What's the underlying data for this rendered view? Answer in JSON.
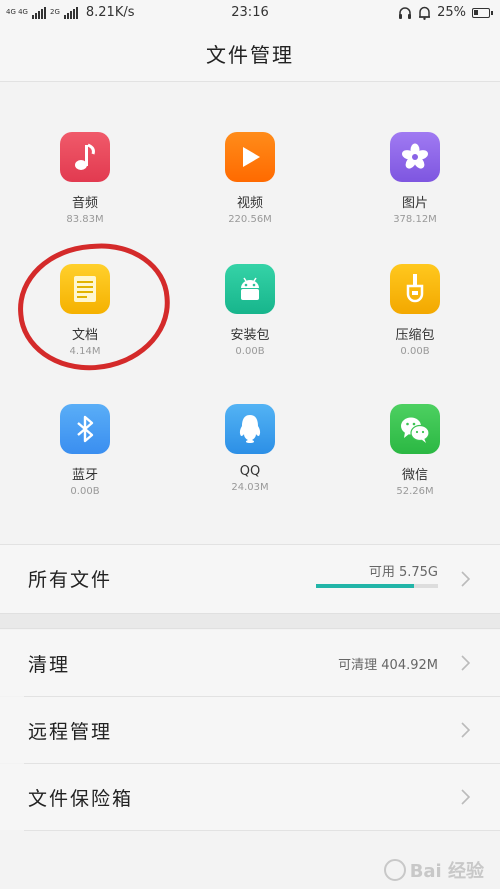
{
  "status_bar": {
    "signal_labels": [
      "4G 4G",
      "2G"
    ],
    "speed": "8.21K/s",
    "time": "23:16",
    "battery": "25%",
    "icons": [
      "headset-icon",
      "bell-icon",
      "battery-icon"
    ]
  },
  "header": {
    "title": "文件管理"
  },
  "categories": [
    {
      "name": "音频",
      "size": "83.83M",
      "icon": "music-icon",
      "color": "#f05a6a",
      "color2": "#e23a50"
    },
    {
      "name": "视频",
      "size": "220.56M",
      "icon": "play-icon",
      "color": "#ff8c1a",
      "color2": "#ff6a00"
    },
    {
      "name": "图片",
      "size": "378.12M",
      "icon": "flower-icon",
      "color": "#a07af2",
      "color2": "#7e56e0"
    },
    {
      "name": "文档",
      "size": "4.14M",
      "icon": "document-icon",
      "color": "#ffd02c",
      "color2": "#f5b100"
    },
    {
      "name": "安装包",
      "size": "0.00B",
      "icon": "android-icon",
      "color": "#35d3a7",
      "color2": "#17b58c"
    },
    {
      "name": "压缩包",
      "size": "0.00B",
      "icon": "zip-icon",
      "color": "#ffc81e",
      "color2": "#f3a800"
    },
    {
      "name": "蓝牙",
      "size": "0.00B",
      "icon": "bluetooth-icon",
      "color": "#5aaef7",
      "color2": "#3a8ef0"
    },
    {
      "name": "QQ",
      "size": "24.03M",
      "icon": "qq-icon",
      "color": "#53b3f4",
      "color2": "#2c8fe6"
    },
    {
      "name": "微信",
      "size": "52.26M",
      "icon": "wechat-icon",
      "color": "#4dd061",
      "color2": "#2bb843"
    }
  ],
  "all_files": {
    "label": "所有文件",
    "available": "可用 5.75G",
    "used_fraction": 0.8
  },
  "menu": [
    {
      "label": "清理",
      "value": "可清理 404.92M"
    },
    {
      "label": "远程管理",
      "value": ""
    },
    {
      "label": "文件保险箱",
      "value": ""
    }
  ],
  "watermark": {
    "text": "Bai 经验"
  },
  "annotation_color": "#d42a2a"
}
